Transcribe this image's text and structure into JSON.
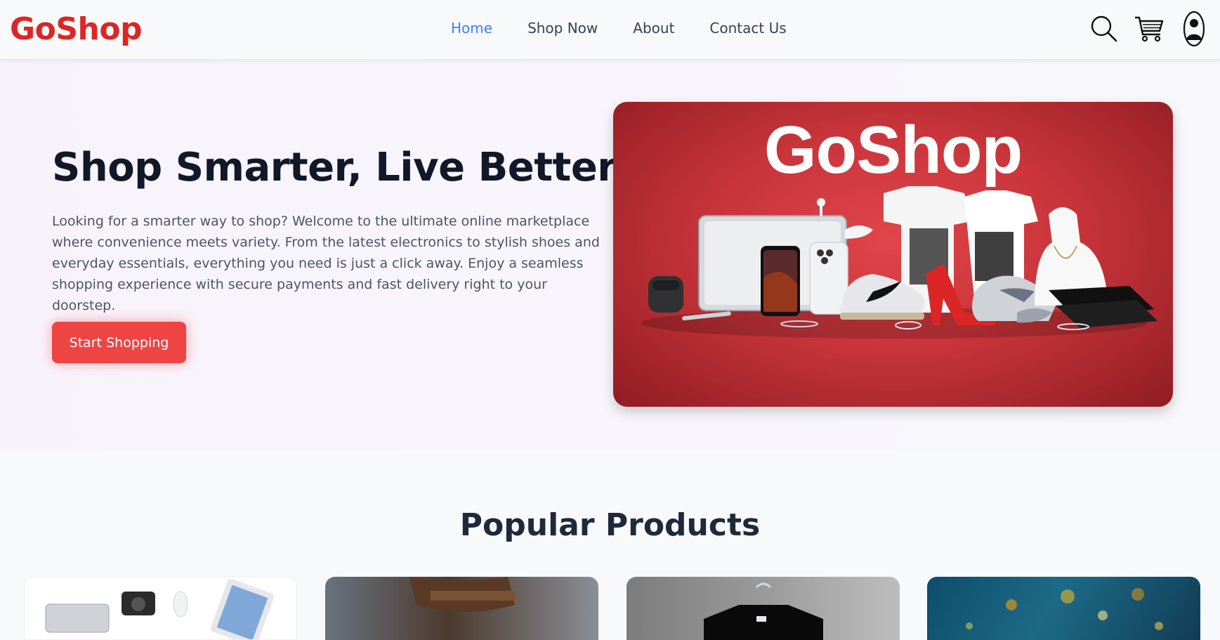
{
  "brand": {
    "name": "GoShop",
    "color": "#dc2626"
  },
  "nav": {
    "links": [
      {
        "label": "Home",
        "active": true
      },
      {
        "label": "Shop Now",
        "active": false
      },
      {
        "label": "About",
        "active": false
      },
      {
        "label": "Contact Us",
        "active": false
      }
    ],
    "icons": [
      "search-icon",
      "cart-icon",
      "user-icon"
    ]
  },
  "hero": {
    "title": "Shop Smarter, Live Better",
    "text": "Looking for a smarter way to shop? Welcome to the ultimate online marketplace where convenience meets variety. From the latest electronics to stylish shoes and everyday essentials, everything you need is just a click away. Enjoy a seamless shopping experience with secure payments and fast delivery right to your doorstep.",
    "button_label": "Start Shopping",
    "image_title": "GoShop"
  },
  "popular": {
    "title": "Popular Products",
    "cards": [
      "electronics",
      "apparel",
      "t-shirts",
      "accessories"
    ]
  },
  "colors": {
    "accent": "#ef4444",
    "active_link": "#3b82f6",
    "hero_image_bg": "#c9353b"
  }
}
